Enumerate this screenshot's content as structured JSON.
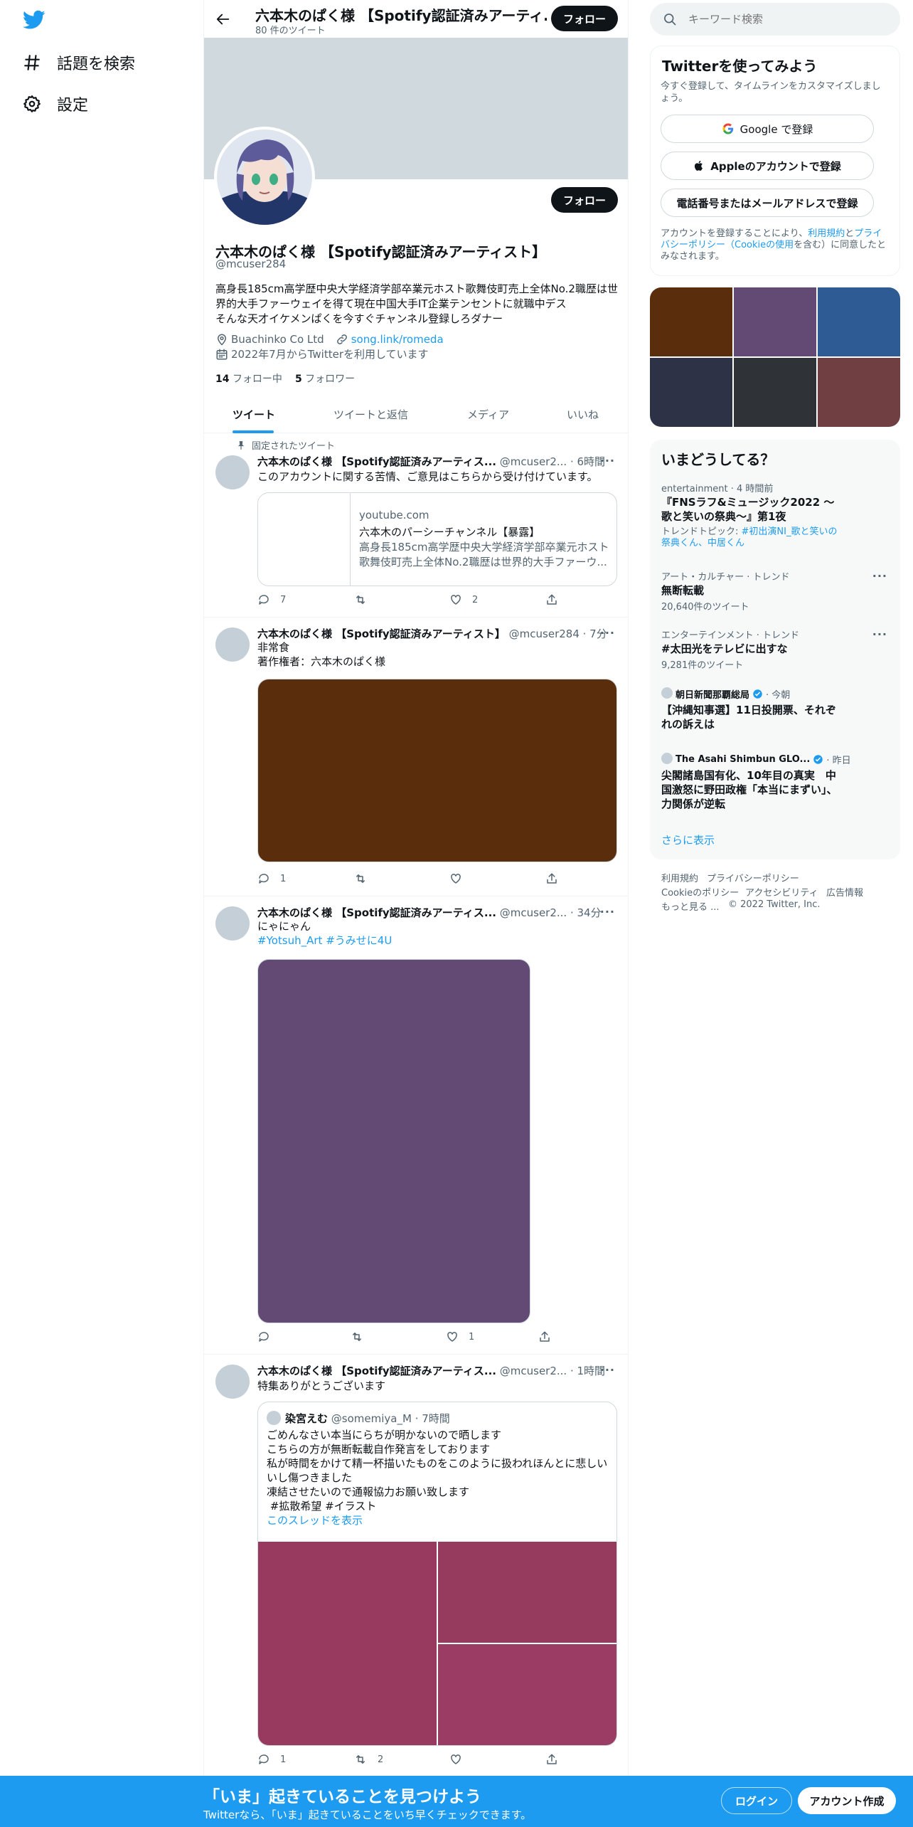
{
  "colors": {
    "accent": "#1d9bf0",
    "dark": "#0f1419",
    "muted": "#536471",
    "banner": "#cfd9de"
  },
  "nav": {
    "items": [
      {
        "label": "話題を検索",
        "icon": "hashtag-icon"
      },
      {
        "label": "設定",
        "icon": "gear-icon"
      }
    ]
  },
  "header": {
    "title": "六本木のぱく様 【Spotify認証済みアーティ...",
    "count": "80 件のツイート",
    "follow": "フォロー"
  },
  "profile": {
    "name": "六本木のぱく様 【Spotify認証済みアーティスト】",
    "handle": "@mcuser284",
    "follow": "フォロー",
    "bio": [
      "高身長185cm高学歴中央大学経済学部卒業元ホスト歌舞伎町売上全体No.2職歴は世",
      "界的大手ファーウェイを得て現在中国大手IT企業テンセントに就職中デス",
      "そんな天才イケメンぱくを今すぐチャンネル登録しろダナー"
    ],
    "location": "Buachinko Co Ltd",
    "url": "song.link/romeda",
    "joined": "2022年7月からTwitterを利用しています",
    "following_count": "14",
    "following_label": "フォロー中",
    "followers_count": "5",
    "followers_label": "フォロワー"
  },
  "tabs": [
    "ツイート",
    "ツイートと返信",
    "メディア",
    "いいね"
  ],
  "tweets": [
    {
      "pinned": "固定されたツイート",
      "name": "六本木のぱく様 【Spotify認証済みアーティス...",
      "meta": "@mcuser2... · 6時間",
      "text": "このアカウントに関する苦情、ご意見はこちらから受け付けています。",
      "card": {
        "domain": "youtube.com",
        "title": "六本木のパーシーチャンネル【暴露】",
        "desc1": "高身長185cm高学歴中央大学経済学部卒業元ホスト",
        "desc2": "歌舞伎町売上全体No.2職歴は世界的大手ファーウ..."
      },
      "replies": "7",
      "retweets": "",
      "likes": "2"
    },
    {
      "name": "六本木のぱく様 【Spotify認証済みアーティスト】",
      "meta": "@mcuser284 · 7分",
      "text1": "非常食",
      "text2": "著作権者：六本木のぱく様",
      "image_color": "#5a2e0c",
      "replies": "1",
      "retweets": "",
      "likes": ""
    },
    {
      "name": "六本木のぱく様 【Spotify認証済みアーティス...",
      "meta": "@mcuser2... · 34分",
      "text": "にゃにゃん",
      "tags": "#Yotsuh_Art #うみせに4U",
      "image_color": "#624a74",
      "replies": "",
      "retweets": "",
      "likes": "1"
    },
    {
      "name": "六本木のぱく様 【Spotify認証済みアーティス...",
      "meta": "@mcuser2... · 1時間",
      "text": "特集ありがとうございます",
      "quote": {
        "name": "染宮えむ",
        "meta": "@somemiya_M · 7時間",
        "lines": [
          "ごめんなさい本当にらちが明かないので晒します",
          "こちらの方が無断転載自作発言をしております",
          "私が時間をかけて精一杯描いたものをこのように扱われほんとに悲しい",
          "いし傷つきました",
          "凍結させたいので通報協力お願い致します"
        ],
        "tags": " #拡散希望 #イラスト",
        "thread": "このスレッドを表示",
        "colors": [
          "#983a60",
          "#963a5e",
          "#9b3c64"
        ]
      },
      "replies": "1",
      "retweets": "2",
      "likes": ""
    }
  ],
  "search": {
    "placeholder": "キーワード検索"
  },
  "signup": {
    "title": "Twitterを使ってみよう",
    "subtitle": "今すぐ登録して、タイムラインをカスタマイズしましょう。",
    "google": "Google で登録",
    "apple": "Appleのアカウントで登録",
    "phone": "電話番号またはメールアドレスで登録",
    "legal_pre": "アカウントを登録することにより、",
    "legal_terms": "利用規約",
    "legal_and": "と",
    "legal_privacy": "プライバシーポリシー",
    "legal_cookie": "（Cookieの使用",
    "legal_post": "を含む）に同意したとみなされます。"
  },
  "media_grid": [
    "#5a2e0c",
    "#624a74",
    "#2e5b93",
    "#2e3246",
    "#2f3236",
    "#703f42"
  ],
  "trends": {
    "title": "いまどうしてる？",
    "items": [
      {
        "context": "entertainment · 4 時間前",
        "title": "『FNSラフ&ミュージック2022 〜歌と笑いの祭典〜』第1夜",
        "topic_label": "トレンドトピック: ",
        "topic": "#初出演NI_歌と笑いの祭典くん、中居くん"
      },
      {
        "context": "アート・カルチャー · トレンド",
        "title": "無断転載",
        "count": "20,640件のツイート"
      },
      {
        "context": "エンターテインメント · トレンド",
        "title": "#太田光をテレビに出すな",
        "count": "9,281件のツイート"
      },
      {
        "source": "朝日新聞那覇総局",
        "time": " · 今朝",
        "title": "【沖縄知事選】11日投開票、それぞれの訴えは"
      },
      {
        "source": "The Asahi Shimbun GLO...",
        "time": " · 昨日",
        "title": "尖閣諸島国有化、10年目の真実　中国激怒に野田政権「本当にまずい」、力関係が逆転"
      }
    ],
    "show_more": "さらに表示"
  },
  "footer": {
    "terms": "利用規約",
    "privacy": "プライバシーポリシー",
    "cookie": "Cookieのポリシー",
    "access": "アクセシビリティ",
    "ads": "広告情報",
    "more": "もっと見る ...",
    "copy": "© 2022 Twitter, Inc."
  },
  "bottom": {
    "title": "「いま」起きていることを見つけよう",
    "subtitle": "Twitterなら、「いま」起きていることをいち早くチェックできます。",
    "login": "ログイン",
    "signup": "アカウント作成"
  }
}
